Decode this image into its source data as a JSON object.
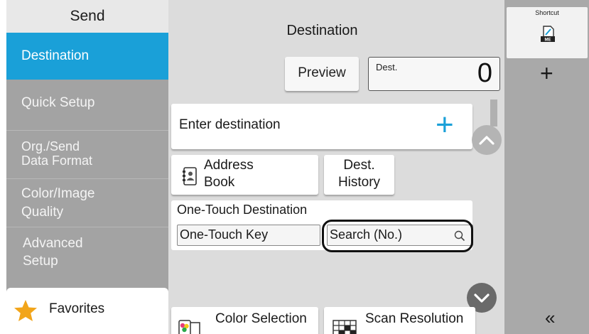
{
  "sidebar": {
    "title": "Send",
    "items": [
      {
        "label": "Destination"
      },
      {
        "label": "Quick Setup"
      },
      {
        "line1": "Org./Send",
        "line2": "Data Format"
      },
      {
        "line1": "Color/Image",
        "line2": "Quality"
      },
      {
        "line1": "Advanced",
        "line2": "Setup"
      }
    ],
    "favorites": {
      "label": "Favorites",
      "icon": "star-icon"
    }
  },
  "main": {
    "title": "Destination",
    "preview_label": "Preview",
    "dest_count_label": "Dest.",
    "dest_count": "0",
    "enter_destination": "Enter destination",
    "address_book": {
      "line1": "Address",
      "line2": "Book"
    },
    "dest_history": {
      "line1": "Dest.",
      "line2": "History"
    },
    "one_touch": {
      "title": "One-Touch Destination",
      "key_label": "One-Touch Key",
      "search_label": "Search (No.)"
    },
    "color_selection": "Color Selection",
    "scan_resolution": "Scan Resolution"
  },
  "right_panel": {
    "shortcut_label": "Shortcut",
    "add_symbol": "+",
    "collapse_symbol": "«"
  },
  "colors": {
    "accent": "#1aa0d8",
    "sidebar_bg": "#a3a3a3",
    "main_bg": "#dcdcdc",
    "right_bg": "#a9a9a9",
    "star": "#f2a51a"
  }
}
